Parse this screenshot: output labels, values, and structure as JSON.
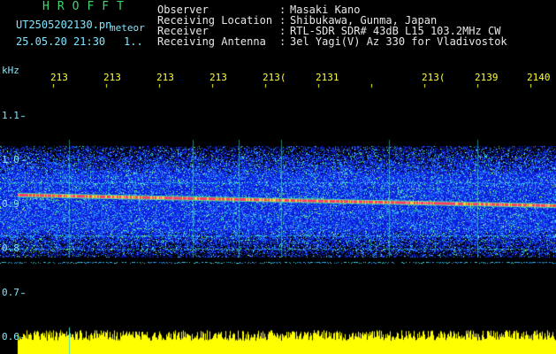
{
  "logo": "HROFFT",
  "file_name": "UT2505202130.pn",
  "meteor_label": "meteor",
  "datetime": "25.05.20 21:30",
  "count": "1..",
  "header": [
    {
      "label": "Observer",
      "value": "Masaki Kano"
    },
    {
      "label": "Receiving Location",
      "value": "Shibukawa, Gunma, Japan"
    },
    {
      "label": "Receiver",
      "value": "RTL-SDR SDR# 43dB L15 103.2MHz CW"
    },
    {
      "label": "Receiving Antenna",
      "value": "3el Yagi(V) Az 330 for Vladivostok"
    }
  ],
  "colon": ":",
  "y_unit": "kHz",
  "x_ticks": [
    "213",
    "213",
    "213",
    "213",
    "213(",
    "2131",
    "213(",
    "2139",
    "2140"
  ],
  "y_ticks": [
    "1.1",
    "1.0",
    "0.9",
    "0.8",
    "0.7",
    "0.6"
  ],
  "colors": {
    "logo": "#3fd66a",
    "text": "#e8e8e8",
    "ticks": "#ffff33",
    "axis_labels": "#7fe7ff",
    "noise": "#1a3cff",
    "signal": "#ff3a6a",
    "amplitude": "#ffff00"
  },
  "chart_data": {
    "type": "heatmap",
    "y_unit": "kHz",
    "y_range": [
      0.6,
      1.15
    ],
    "noise_band_khz": [
      0.78,
      1.03
    ],
    "main_signal_khz": {
      "start": 0.923,
      "end": 0.898
    },
    "secondary_lines_khz": [
      0.95,
      0.83,
      0.8,
      0.77
    ]
  }
}
